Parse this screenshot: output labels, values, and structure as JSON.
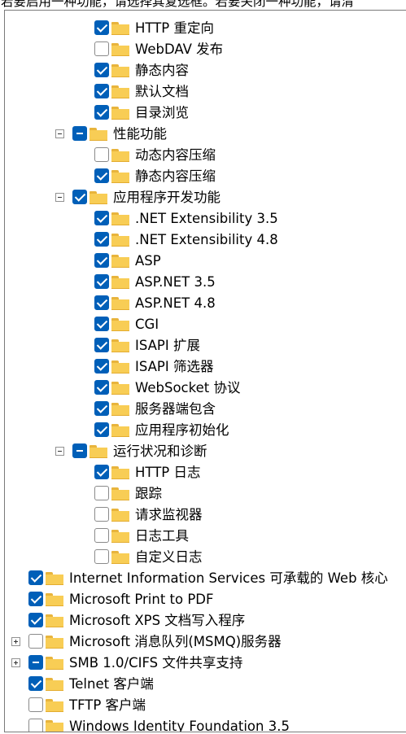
{
  "header": {
    "text": "若要启用一种功能，请选择其复选框。若要关闭一种功能，请清"
  },
  "tree": {
    "items": [
      {
        "label": "HTTP 重定向",
        "state": "checked",
        "expander": "none"
      },
      {
        "label": "WebDAV 发布",
        "state": "unchecked",
        "expander": "none"
      },
      {
        "label": "静态内容",
        "state": "checked",
        "expander": "none"
      },
      {
        "label": "默认文档",
        "state": "checked",
        "expander": "none"
      },
      {
        "label": "目录浏览",
        "state": "checked",
        "expander": "none"
      },
      {
        "label": "性能功能",
        "state": "partial",
        "expander": "expanded"
      },
      {
        "label": "动态内容压缩",
        "state": "unchecked",
        "expander": "none"
      },
      {
        "label": "静态内容压缩",
        "state": "checked",
        "expander": "none"
      },
      {
        "label": "应用程序开发功能",
        "state": "checked",
        "expander": "expanded"
      },
      {
        "label": ".NET Extensibility 3.5",
        "state": "checked",
        "expander": "none"
      },
      {
        "label": ".NET Extensibility 4.8",
        "state": "checked",
        "expander": "none"
      },
      {
        "label": "ASP",
        "state": "checked",
        "expander": "none"
      },
      {
        "label": "ASP.NET 3.5",
        "state": "checked",
        "expander": "none"
      },
      {
        "label": "ASP.NET 4.8",
        "state": "checked",
        "expander": "none"
      },
      {
        "label": "CGI",
        "state": "checked",
        "expander": "none"
      },
      {
        "label": "ISAPI 扩展",
        "state": "checked",
        "expander": "none"
      },
      {
        "label": "ISAPI 筛选器",
        "state": "checked",
        "expander": "none"
      },
      {
        "label": "WebSocket 协议",
        "state": "checked",
        "expander": "none"
      },
      {
        "label": "服务器端包含",
        "state": "checked",
        "expander": "none"
      },
      {
        "label": "应用程序初始化",
        "state": "checked",
        "expander": "none"
      },
      {
        "label": "运行状况和诊断",
        "state": "partial",
        "expander": "expanded"
      },
      {
        "label": "HTTP 日志",
        "state": "checked",
        "expander": "none"
      },
      {
        "label": "跟踪",
        "state": "unchecked",
        "expander": "none"
      },
      {
        "label": "请求监视器",
        "state": "unchecked",
        "expander": "none"
      },
      {
        "label": "日志工具",
        "state": "unchecked",
        "expander": "none"
      },
      {
        "label": "自定义日志",
        "state": "unchecked",
        "expander": "none"
      },
      {
        "label": "Internet Information Services 可承载的 Web 核心",
        "state": "checked",
        "expander": "none"
      },
      {
        "label": "Microsoft Print to PDF",
        "state": "checked",
        "expander": "none"
      },
      {
        "label": "Microsoft XPS 文档写入程序",
        "state": "checked",
        "expander": "none"
      },
      {
        "label": "Microsoft 消息队列(MSMQ)服务器",
        "state": "unchecked",
        "expander": "collapsed"
      },
      {
        "label": "SMB 1.0/CIFS 文件共享支持",
        "state": "partial",
        "expander": "collapsed"
      },
      {
        "label": "Telnet 客户端",
        "state": "checked",
        "expander": "none"
      },
      {
        "label": "TFTP 客户端",
        "state": "unchecked",
        "expander": "none"
      },
      {
        "label": "Windows Identity Foundation 3.5",
        "state": "unchecked",
        "expander": "none"
      }
    ]
  }
}
